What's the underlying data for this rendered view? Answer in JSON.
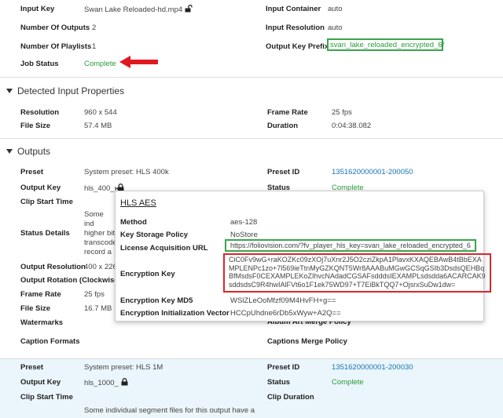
{
  "input": {
    "key_label": "Input Key",
    "key_value": "Swan Lake Reloaded-hd.mp4",
    "outputs_label": "Number Of Outputs",
    "outputs_value": "2",
    "playlists_label": "Number Of Playlists",
    "playlists_value": "1",
    "status_label": "Job Status",
    "status_value": "Complete",
    "container_label": "Input Container",
    "container_value": "auto",
    "resolution_label": "Input Resolution",
    "resolution_value": "auto",
    "prefix_label": "Output Key Prefix",
    "prefix_value": "svan_lake_reloaded_encrypted_6/"
  },
  "detected": {
    "title": "Detected Input Properties",
    "resolution_label": "Resolution",
    "resolution_value": "960 x 544",
    "filesize_label": "File Size",
    "filesize_value": "57.4 MB",
    "framerate_label": "Frame Rate",
    "framerate_value": "25 fps",
    "duration_label": "Duration",
    "duration_value": "0:04:38.082"
  },
  "outputs": {
    "title": "Outputs",
    "o1": {
      "preset_label": "Preset",
      "preset_value": "System preset: HLS 400k",
      "key_label": "Output Key",
      "key_value": "hls_400_",
      "clip_label": "Clip Start Time",
      "status_details_label": "Status Details",
      "status_details_value": "Some ind higher bit transcode record a h preset.",
      "resolution_label": "Output Resolution",
      "resolution_value": "400 x 226",
      "rotation_label": "Output Rotation (Clockwise",
      "framerate_label": "Frame Rate",
      "framerate_value": "25 fps",
      "filesize_label": "File Size",
      "filesize_value": "16.7 MB",
      "watermarks_label": "Watermarks",
      "caption_label": "Caption Formats",
      "preset_id_label": "Preset ID",
      "preset_id_value": "1351620000001-200050",
      "status_label": "Status",
      "status_value": "Complete",
      "album_label": "Album Art Merge Policy",
      "caption_merge_label": "Captions Merge Policy"
    },
    "o2": {
      "preset_label": "Preset",
      "preset_value": "System preset: HLS 1M",
      "key_label": "Output Key",
      "key_value": "hls_1000_",
      "clip_label": "Clip Start Time",
      "note": "Some individual segment files for this output have a",
      "preset_id_label": "Preset ID",
      "preset_id_value": "1351620000001-200030",
      "status_label": "Status",
      "status_value": "Complete",
      "clip_duration_label": "Clip Duration"
    }
  },
  "popup": {
    "title": "HLS AES",
    "method_label": "Method",
    "method_value": "aes-128",
    "storage_label": "Key Storage Policy",
    "storage_value": "NoStore",
    "url_label": "License Acquisition URL",
    "url_value": "https://foliovision.com/?fv_player_hls_key=svan_lake_reloaded_encrypted_6",
    "enc_label": "Encryption Key",
    "enc_value": "CiC0Fv9wG+raKOZKc09zXOj7uXnr2J5O2cziZkpA1PlavxKXAQEBAwB4tBbEXAMPLENPc1zo+7l569ieTtnMyGZKQNT5Wr8AAABuMGwGCSqGSIb3DsdsQEHBqBfMsdsF0CEXAMPLEKoZIhvcNAdadCGSAFsdddsIEXAMPLsdsdda6ACARCAK9sddsdsC9R4hwIAlFVt6o1F1ek75WD97+T7EiBkTQQ7+OjsrxSuDw1dw=",
    "md5_label": "Encryption Key MD5",
    "md5_value": "WSlZLeOoMfzf09M4HvFH+g==",
    "iv_label": "Encryption Initialization Vector",
    "iv_value": "HCCpUhdne6rDb5xWyw+A2Q=="
  }
}
